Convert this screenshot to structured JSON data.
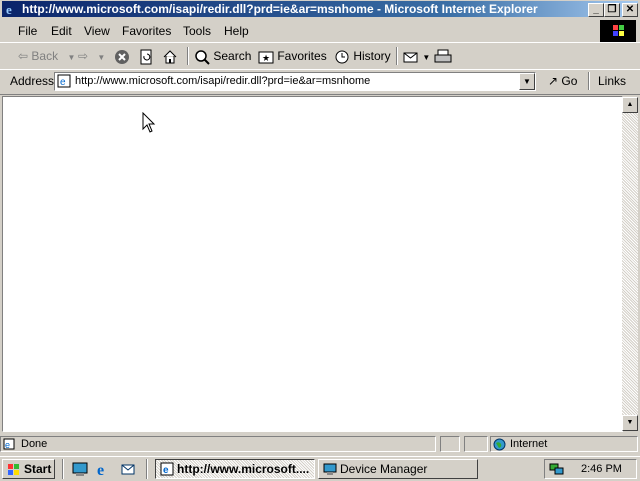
{
  "window": {
    "title": "http://www.microsoft.com/isapi/redir.dll?prd=ie&ar=msnhome - Microsoft Internet Explorer",
    "minimize_glyph": "_",
    "maximize_glyph": "❐",
    "close_glyph": "✕"
  },
  "menu": {
    "items": [
      "File",
      "Edit",
      "View",
      "Favorites",
      "Tools",
      "Help"
    ]
  },
  "toolbar": {
    "back_label": "Back",
    "search_label": "Search",
    "favorites_label": "Favorites",
    "history_label": "History"
  },
  "address": {
    "label": "Address",
    "value": "http://www.microsoft.com/isapi/redir.dll?prd=ie&ar=msnhome",
    "go_label": "Go",
    "links_label": "Links"
  },
  "status": {
    "text": "Done",
    "zone": "Internet"
  },
  "taskbar": {
    "start_label": "Start",
    "tasks": [
      "http://www.microsoft....",
      "Device Manager"
    ],
    "clock": "2:46 PM"
  },
  "colors": {
    "title_active": "#0a246a",
    "face": "#d4d0c8",
    "desktop": "#008080"
  }
}
